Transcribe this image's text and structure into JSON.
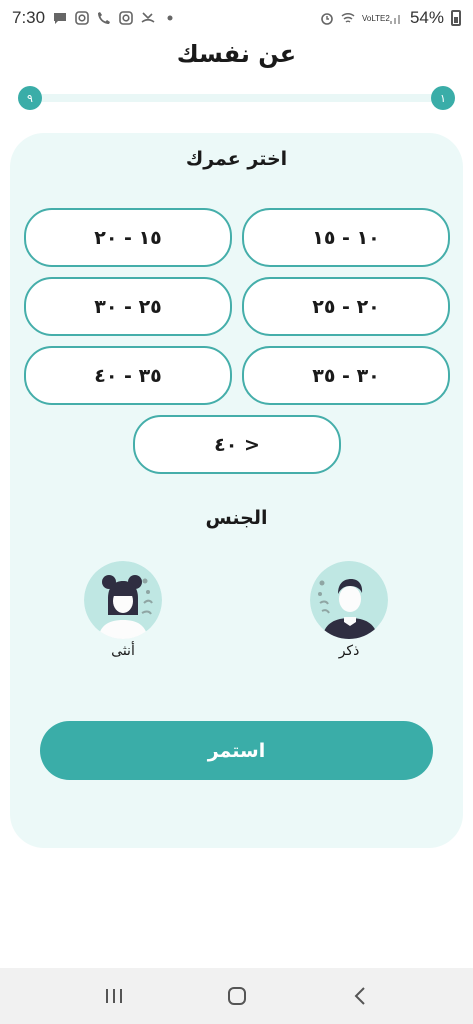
{
  "status_bar": {
    "time": "7:30",
    "battery": "54%",
    "network": "VoLTE2",
    "left_icons": [
      "message-icon",
      "instagram-icon",
      "phone-icon",
      "instagram-icon",
      "missed-call-icon",
      "dot-icon"
    ],
    "right_icons": [
      "alarm-icon",
      "wifi-icon",
      "signal-icon",
      "signal-icon",
      "battery-icon"
    ]
  },
  "header": {
    "title": "عن نفسك"
  },
  "progress": {
    "start_label": "١",
    "end_label": "٩",
    "value": 0,
    "accent": "#3aada8",
    "track": "#e9f7f6"
  },
  "age": {
    "title": "اختر عمرك",
    "options": [
      "١٠ - ١٥",
      "١٥ - ٢٠",
      "٢٠ - ٢٥",
      "٢٥ - ٣٠",
      "٣٠ - ٣٥",
      "٣٥ - ٤٠",
      "< ٤٠"
    ]
  },
  "gender": {
    "title": "الجنس",
    "male_label": "ذكر",
    "female_label": "أنثى"
  },
  "continue_label": "استمر",
  "colors": {
    "accent": "#3aada8",
    "card_bg": "#ecf9f8",
    "avatar_bg": "#bfe7e3",
    "dark": "#2f2e41"
  },
  "nav_icons": [
    "recents-icon",
    "home-icon",
    "back-icon"
  ]
}
